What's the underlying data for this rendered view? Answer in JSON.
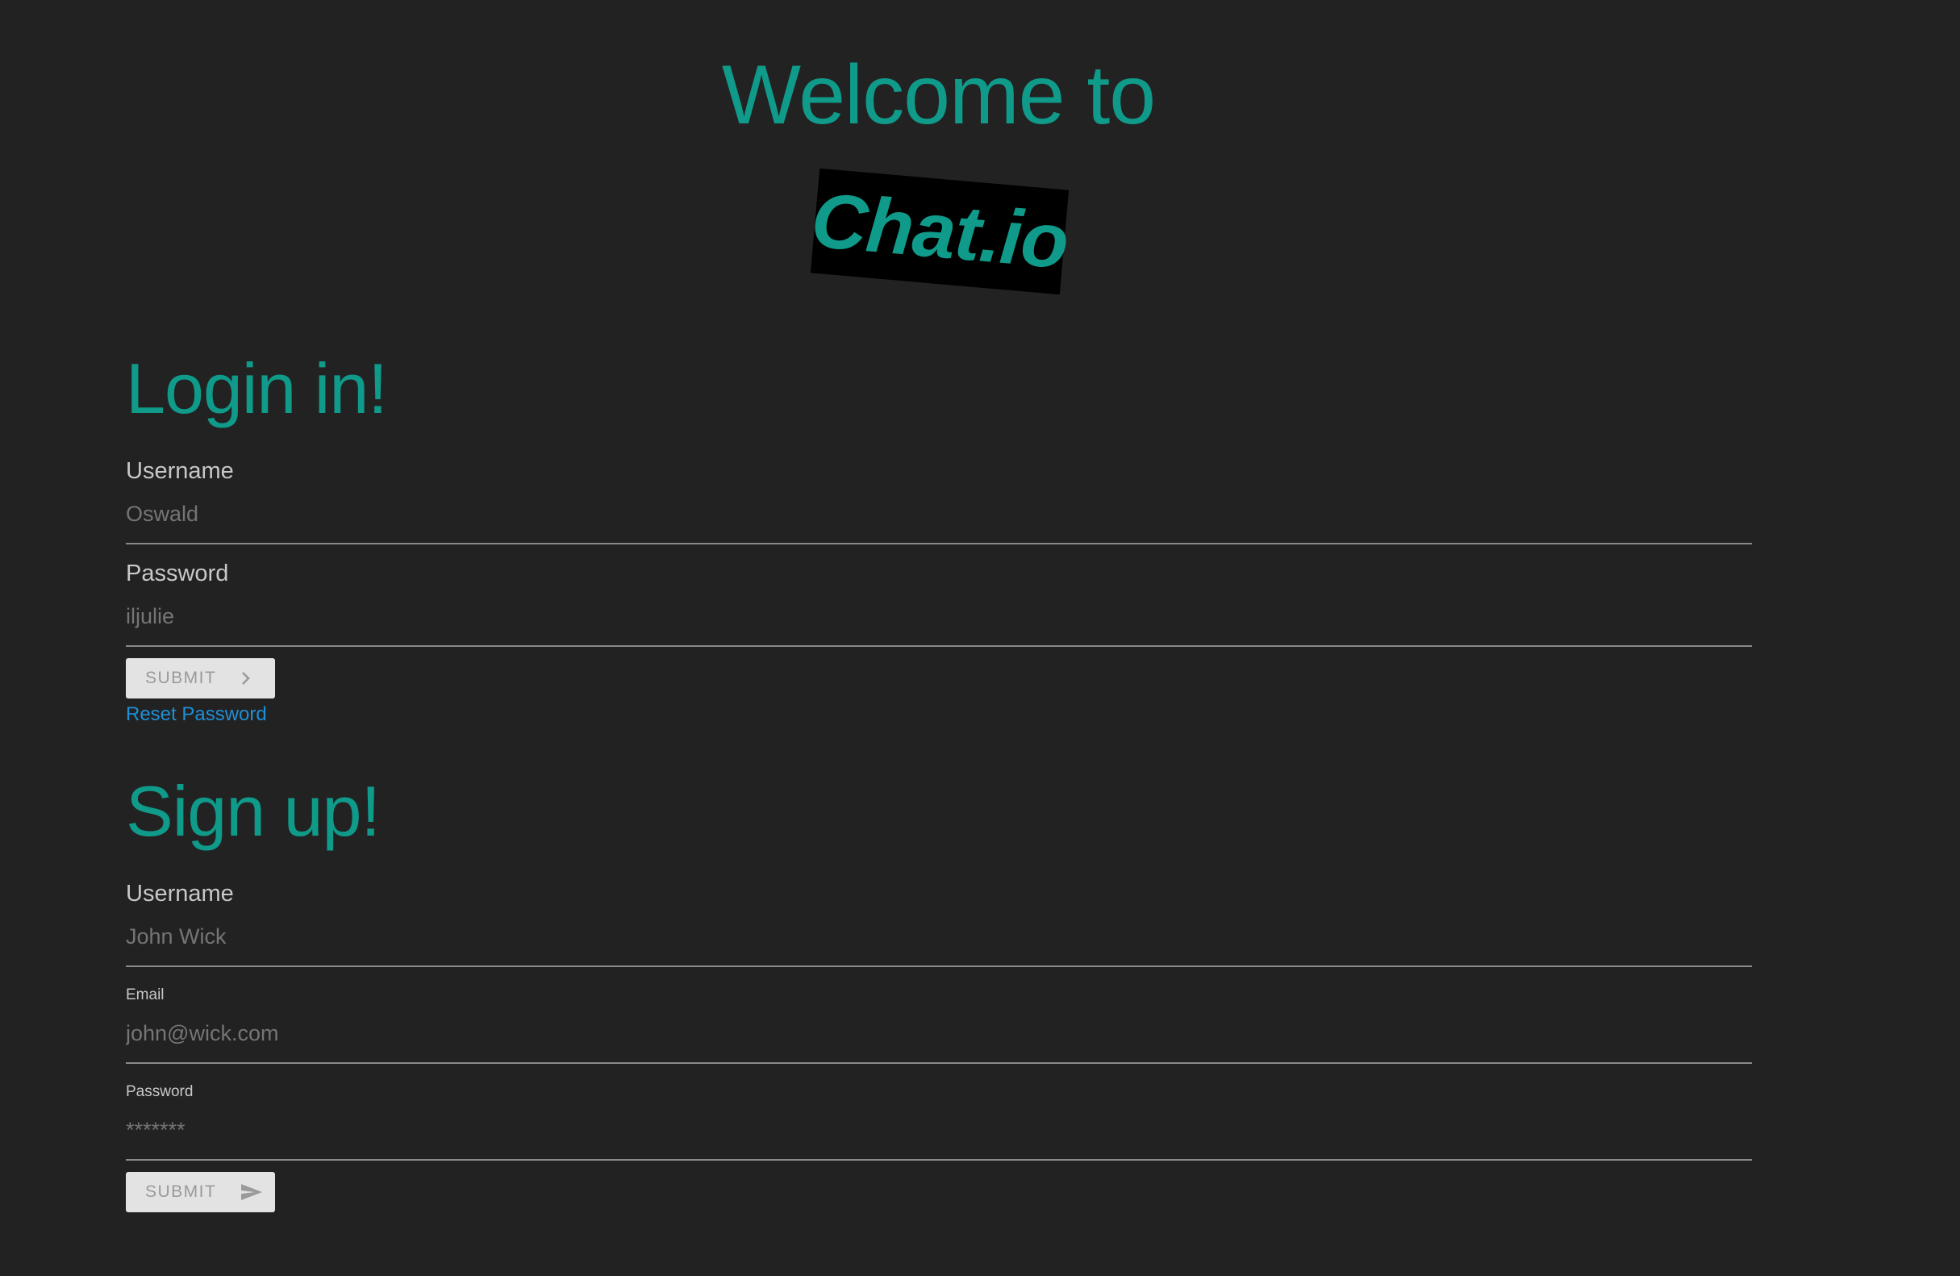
{
  "header": {
    "welcome": "Welcome to",
    "logo": "Chat.io"
  },
  "login": {
    "title": "Login in!",
    "username_label": "Username",
    "username_value": "Oswald",
    "password_label": "Password",
    "password_value": "iljulie",
    "submit_label": "SUBMIT",
    "reset_label": "Reset Password"
  },
  "signup": {
    "title": "Sign up!",
    "username_label": "Username",
    "username_value": "John Wick",
    "email_label": "Email",
    "email_value": "john@wick.com",
    "password_label": "Password",
    "password_value": "*******",
    "submit_label": "SUBMIT"
  },
  "colors": {
    "background": "#222222",
    "accent": "#0f9a8a",
    "link": "#1e8fd6",
    "button_bg": "#e3e3e3"
  },
  "icons": {
    "login_submit": "chevron-right-icon",
    "signup_submit": "send-icon"
  }
}
